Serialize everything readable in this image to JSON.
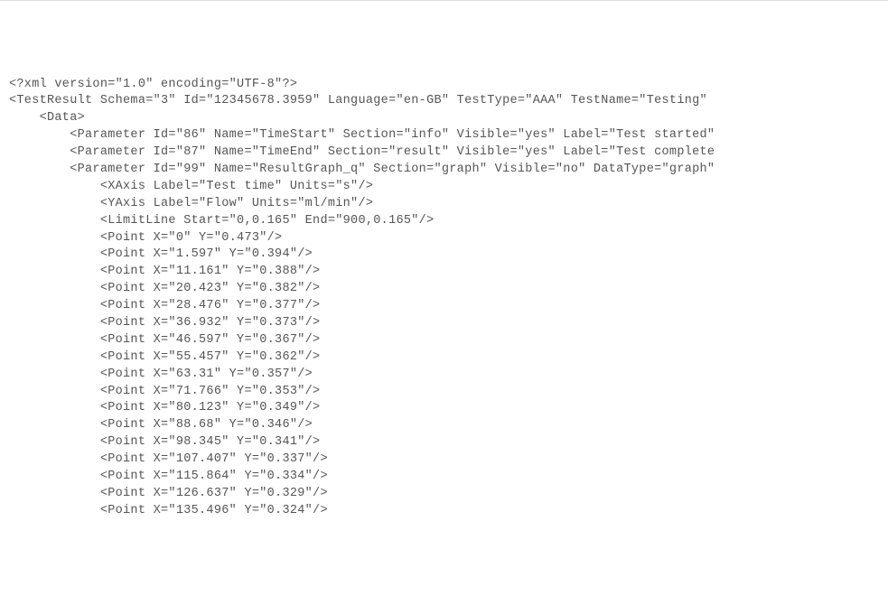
{
  "lines": [
    "<?xml version=\"1.0\" encoding=\"UTF-8\"?>",
    "<TestResult Schema=\"3\" Id=\"12345678.3959\" Language=\"en-GB\" TestType=\"AAA\" TestName=\"Testing\"",
    "    <Data>",
    "        <Parameter Id=\"86\" Name=\"TimeStart\" Section=\"info\" Visible=\"yes\" Label=\"Test started\"",
    "        <Parameter Id=\"87\" Name=\"TimeEnd\" Section=\"result\" Visible=\"yes\" Label=\"Test complete",
    "        <Parameter Id=\"99\" Name=\"ResultGraph_q\" Section=\"graph\" Visible=\"no\" DataType=\"graph\"",
    "            <XAxis Label=\"Test time\" Units=\"s\"/>",
    "            <YAxis Label=\"Flow\" Units=\"ml/min\"/>",
    "            <LimitLine Start=\"0,0.165\" End=\"900,0.165\"/>",
    "            <Point X=\"0\" Y=\"0.473\"/>",
    "            <Point X=\"1.597\" Y=\"0.394\"/>",
    "            <Point X=\"11.161\" Y=\"0.388\"/>",
    "            <Point X=\"20.423\" Y=\"0.382\"/>",
    "            <Point X=\"28.476\" Y=\"0.377\"/>",
    "            <Point X=\"36.932\" Y=\"0.373\"/>",
    "            <Point X=\"46.597\" Y=\"0.367\"/>",
    "            <Point X=\"55.457\" Y=\"0.362\"/>",
    "            <Point X=\"63.31\" Y=\"0.357\"/>",
    "            <Point X=\"71.766\" Y=\"0.353\"/>",
    "            <Point X=\"80.123\" Y=\"0.349\"/>",
    "            <Point X=\"88.68\" Y=\"0.346\"/>",
    "            <Point X=\"98.345\" Y=\"0.341\"/>",
    "            <Point X=\"107.407\" Y=\"0.337\"/>",
    "            <Point X=\"115.864\" Y=\"0.334\"/>",
    "            <Point X=\"126.637\" Y=\"0.329\"/>",
    "            <Point X=\"135.496\" Y=\"0.324\"/>"
  ]
}
